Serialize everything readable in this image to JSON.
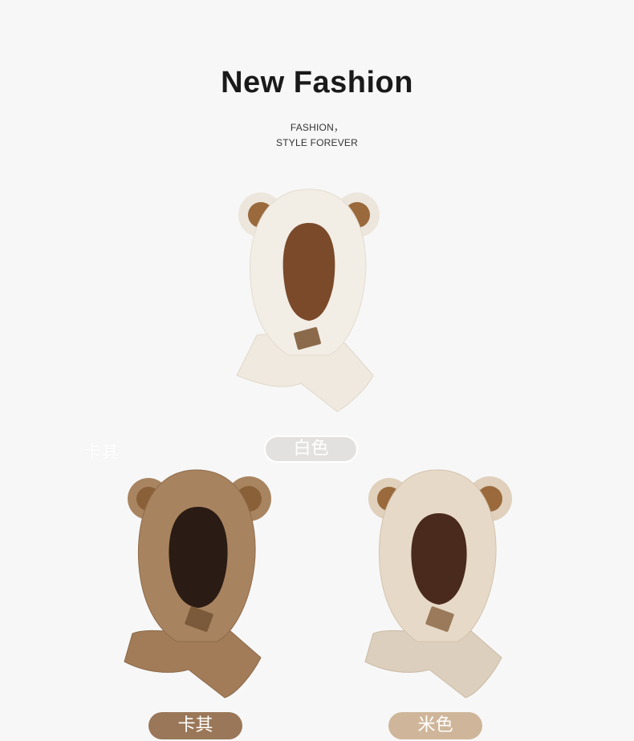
{
  "header": {
    "title": "New Fashion",
    "subtitle_line1": "FASHION，",
    "subtitle_line2": "STYLE FOREVER"
  },
  "products": [
    {
      "label": "白色",
      "fur_color": "#f0ebe3",
      "inner_color": "#7a4a2a",
      "ear_inner": "#9a6a3c"
    },
    {
      "label": "卡其",
      "fur_color": "#a47e5a",
      "inner_color": "#2a1c14",
      "ear_inner": "#8a6038"
    },
    {
      "label": "米色",
      "fur_color": "#e3d5c2",
      "inner_color": "#4a2a1c",
      "ear_inner": "#9a6a3c"
    }
  ],
  "watermark_text": "卡其",
  "colors": {
    "background": "#f7f7f7",
    "pill_white": "#e3e1df",
    "pill_khaki": "#9a7758",
    "pill_beige": "#cfb69a"
  }
}
